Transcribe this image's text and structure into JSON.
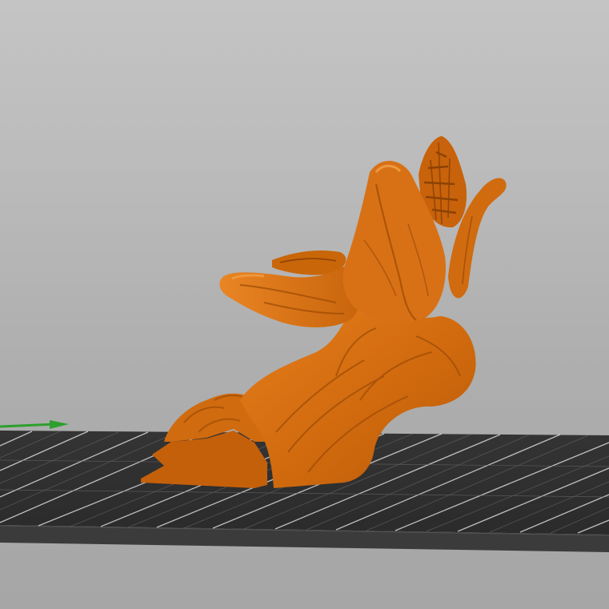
{
  "scene": {
    "background_top": "#c4c4c4",
    "background_bottom": "#a6a6a6",
    "bed_surface": "#2f2f2f",
    "bed_edge": "#3f3f3f",
    "grid_lines": "#dcdcdc",
    "model_color": "#d86f10",
    "model_shadow": "#a34f06",
    "model_highlight": "#f0892a",
    "axis_x_color": "#2da02d",
    "icons": {
      "axis_arrow": "axis-arrow-icon"
    }
  }
}
